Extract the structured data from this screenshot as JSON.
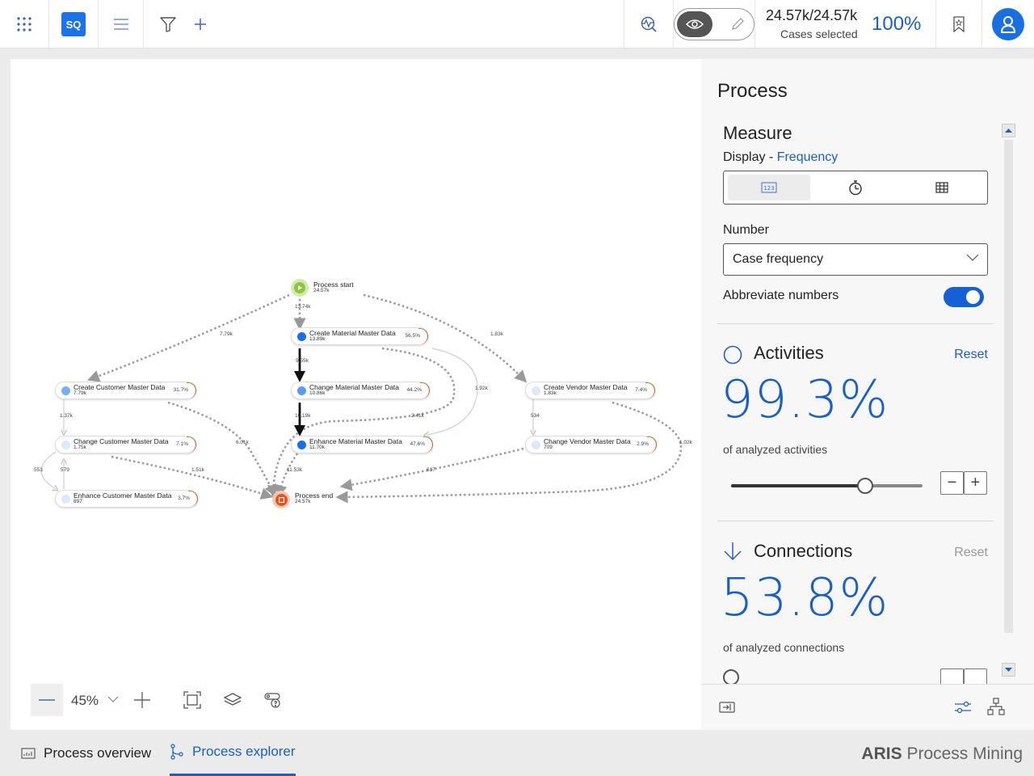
{
  "topbar": {
    "app_initials": "SQ",
    "cases_count": "24.57k/24.57k",
    "cases_label": "Cases selected",
    "cases_percent": "100%",
    "icons": [
      "apps-grid-icon",
      "menu-icon",
      "filter-icon",
      "add-icon",
      "process-analysis-icon",
      "view-mode-eye-icon",
      "edit-mode-pencil-icon",
      "bookmark-icon",
      "user-icon"
    ]
  },
  "graph": {
    "start": {
      "name": "Process start",
      "count": "24.57k"
    },
    "end": {
      "name": "Process end",
      "count": "24.57k"
    },
    "nodes": [
      {
        "name": "Create Material Master Data",
        "count": "13.89k",
        "pct": "56.5%",
        "color": "#1a6fe8"
      },
      {
        "name": "Change Material Master Data",
        "count": "10.86k",
        "pct": "44.2%",
        "color": "#5b9cf0"
      },
      {
        "name": "Enhance Material Master Data",
        "count": "11.70k",
        "pct": "47.6%",
        "color": "#1a6fe8"
      },
      {
        "name": "Create Customer Master Data",
        "count": "7.79k",
        "pct": "31.7%",
        "color": "#7aaef2"
      },
      {
        "name": "Change Customer Master Data",
        "count": "1.75k",
        "pct": "7.1%",
        "color": "#dde8f8"
      },
      {
        "name": "Enhance Customer Master Data",
        "count": "897",
        "pct": "3.7%",
        "color": "#dde8f8"
      },
      {
        "name": "Create Vendor Master Data",
        "count": "1.83k",
        "pct": "7.4%",
        "color": "#dde8f8"
      },
      {
        "name": "Change Vendor Master Data",
        "count": "709",
        "pct": "2.9%",
        "color": "#dde8f8"
      }
    ],
    "edge_labels": [
      "13.74k",
      "7.79k",
      "1.83k",
      "9.55k",
      "1.92k",
      "10.19k",
      "2.41k",
      "1.37k",
      "6.01k",
      "534",
      "1.02k",
      "553",
      "579",
      "1.51k",
      "11.53k",
      "617"
    ]
  },
  "zoom_controls": {
    "zoom_level": "45%",
    "icons": [
      "zoom-out-icon",
      "chevron-down-icon",
      "zoom-in-icon",
      "fit-to-screen-icon",
      "layers-icon",
      "legend-help-icon"
    ]
  },
  "panel": {
    "title": "Process",
    "measure": {
      "title": "Measure",
      "display_prefix": "Display - ",
      "display_value": "Frequency",
      "display_options": [
        "frequency-123-icon",
        "duration-stopwatch-icon",
        "table-icon"
      ],
      "number_label": "Number",
      "number_value": "Case frequency",
      "abbreviate_label": "Abbreviate numbers",
      "abbreviate_on": true
    },
    "activities": {
      "title": "Activities",
      "reset": "Reset",
      "percent": "99.3%",
      "sub": "of analyzed activities",
      "slider_fraction": 0.7
    },
    "connections": {
      "title": "Connections",
      "reset": "Reset",
      "percent": "53.8%",
      "sub": "of analyzed connections"
    },
    "footer_icons": [
      "export-icon",
      "settings-sliders-icon",
      "hierarchy-icon"
    ]
  },
  "bottom_tabs": [
    {
      "label": "Process overview",
      "active": false
    },
    {
      "label": "Process explorer",
      "active": true
    }
  ],
  "brand": {
    "bold": "ARIS",
    "rest": " Process Mining"
  },
  "colors": {
    "accent": "#1a5fc8",
    "brand_blue": "#1a73e8",
    "start_green": "#8cc63f",
    "end_orange": "#e8521c"
  }
}
